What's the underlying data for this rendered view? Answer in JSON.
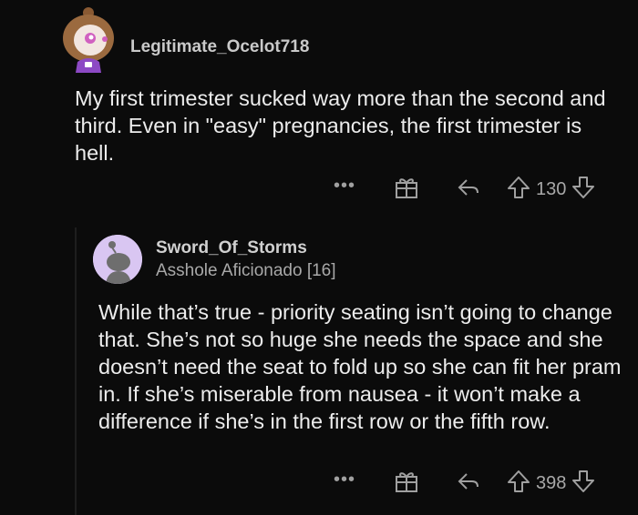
{
  "comments": [
    {
      "username": "Legitimate_Ocelot718",
      "flair": "",
      "body": "My first trimester sucked way more than the second and third. Even in \"easy\" pregnancies, the first trimester is hell.",
      "score": "130",
      "more_label": "•••"
    },
    {
      "username": "Sword_Of_Storms",
      "flair": "Asshole Aficionado [16]",
      "body": "While that’s true - priority seating isn’t going to change that. She’s not so huge she needs the space and she doesn’t need the seat to fold up so she can fit her pram in. If she’s miserable from nausea - it won’t make a difference if she’s in the first row or the fifth row.",
      "score": "398",
      "more_label": "•••"
    }
  ],
  "icons": {
    "more": "more-options-icon",
    "award": "award-gift-icon",
    "reply": "reply-arrow-icon",
    "upvote": "upvote-arrow-icon",
    "downvote": "downvote-arrow-icon"
  },
  "colors": {
    "background": "#0b0b0b",
    "text": "#ececec",
    "meta": "#a8a8a8",
    "avatar2_bg": "#d9c6f2"
  }
}
